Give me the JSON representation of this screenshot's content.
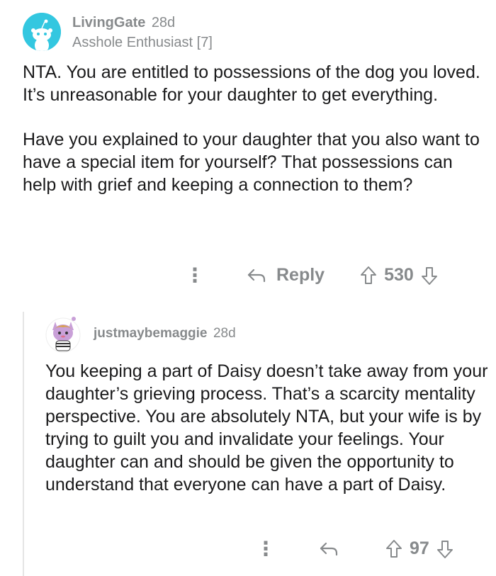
{
  "comment": {
    "username": "LivingGate",
    "time": "28d",
    "flair": "Asshole Enthusiast [7]",
    "paragraphs": [
      "NTA. You are entitled to possessions of the dog you loved. It’s unreasonable for your daughter to get everything.",
      "Have you explained to your daughter that you also want to have a special item for yourself? That possessions can help with grief and keeping a connection to them?"
    ],
    "reply_label": "Reply",
    "vote_count": "530",
    "avatar_color": "#33c7e0"
  },
  "reply": {
    "username": "justmaybemaggie",
    "time": "28d",
    "paragraphs": [
      "You keeping a part of Daisy doesn’t take away from your daughter’s grieving process. That’s a scarcity mentality perspective. You are absolutely NTA, but your wife is by trying to guilt you and invalidate your feelings. Your daughter can and should be given the opportunity to understand that everyone can have a part of Daisy."
    ],
    "vote_count": "97"
  },
  "icons": {
    "more": "more-options-icon",
    "reply": "reply-arrow-icon",
    "upvote": "upvote-arrow-icon",
    "downvote": "downvote-arrow-icon"
  }
}
